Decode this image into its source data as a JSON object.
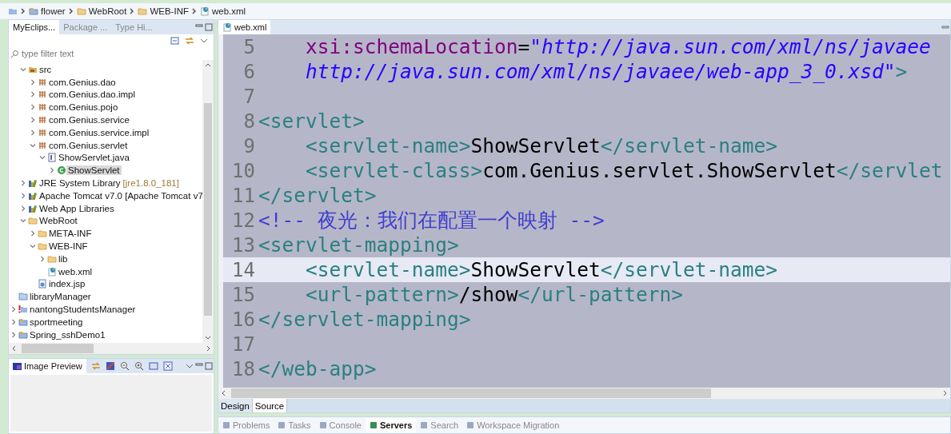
{
  "breadcrumb": [
    {
      "label": "flower",
      "kind": "project"
    },
    {
      "label": "WebRoot",
      "kind": "folder"
    },
    {
      "label": "WEB-INF",
      "kind": "folder"
    },
    {
      "label": "web.xml",
      "kind": "xml-file"
    }
  ],
  "explorer": {
    "tabs": [
      {
        "label": "MyEclips...",
        "selected": true
      },
      {
        "label": "Package ...",
        "selected": false
      },
      {
        "label": "Type Hi...",
        "selected": false
      }
    ],
    "filter": {
      "placeholder": "type filter text"
    },
    "tree": [
      {
        "children": [
          {
            "label": "src",
            "kind": "package-root",
            "expanded": true,
            "children": [
              {
                "label": "com.Genius.dao",
                "kind": "package",
                "expanded": false
              },
              {
                "label": "com.Genius.dao.impl",
                "kind": "package",
                "expanded": false
              },
              {
                "label": "com.Genius.pojo",
                "kind": "package",
                "expanded": false
              },
              {
                "label": "com.Genius.service",
                "kind": "package",
                "expanded": false
              },
              {
                "label": "com.Genius.service.impl",
                "kind": "package",
                "expanded": false
              },
              {
                "label": "com.Genius.servlet",
                "kind": "package",
                "expanded": true,
                "children": [
                  {
                    "label": "ShowServlet.java",
                    "kind": "java-file",
                    "expanded": true,
                    "children": [
                      {
                        "label": "ShowServlet",
                        "kind": "class",
                        "expanded": false,
                        "selected": true
                      }
                    ]
                  }
                ]
              }
            ]
          },
          {
            "label": "JRE System Library",
            "decoration": "[jre1.8.0_181]",
            "kind": "library",
            "expanded": false
          },
          {
            "label": "Apache Tomcat v7.0 [Apache Tomcat v7",
            "kind": "library",
            "expanded": false
          },
          {
            "label": "Web App Libraries",
            "kind": "library",
            "expanded": false
          },
          {
            "label": "WebRoot",
            "kind": "folder",
            "expanded": true,
            "children": [
              {
                "label": "META-INF",
                "kind": "folder",
                "expanded": false
              },
              {
                "label": "WEB-INF",
                "kind": "folder",
                "expanded": true,
                "children": [
                  {
                    "label": "lib",
                    "kind": "folder",
                    "expanded": false
                  },
                  {
                    "label": "web.xml",
                    "kind": "xml-file"
                  }
                ]
              },
              {
                "label": "index.jsp",
                "kind": "jsp-file"
              }
            ]
          }
        ]
      },
      {
        "label": "libraryManager",
        "kind": "closed-project"
      },
      {
        "label": "nantongStudentsManager",
        "kind": "project-error",
        "expanded": false
      },
      {
        "label": "sportmeeting",
        "kind": "project",
        "expanded": false
      },
      {
        "label": "Spring_sshDemo1",
        "kind": "project",
        "expanded": false
      }
    ]
  },
  "preview": {
    "tab": "Image Preview"
  },
  "editor": {
    "tab": "web.xml",
    "lines": [
      {
        "number": "5",
        "current": false,
        "tokens": [
          {
            "kind": "attr",
            "text": "    xsi:schemaLocation"
          },
          {
            "kind": "text",
            "text": "="
          },
          {
            "kind": "value",
            "text": "\"http://java.sun.com/xml/ns/javaee"
          }
        ]
      },
      {
        "number": "6",
        "current": false,
        "tokens": [
          {
            "kind": "value",
            "text": "    http://java.sun.com/xml/ns/javaee/web-app_3_0.xsd\""
          },
          {
            "kind": "tag",
            "text": ">"
          }
        ]
      },
      {
        "number": "7",
        "current": false
      },
      {
        "number": "8",
        "current": false,
        "tokens": [
          {
            "kind": "tag",
            "text": "<servlet>"
          }
        ]
      },
      {
        "number": "9",
        "current": false,
        "tokens": [
          {
            "kind": "tag",
            "text": "    <servlet-name>"
          },
          {
            "kind": "text",
            "text": "ShowServlet"
          },
          {
            "kind": "tag",
            "text": "</servlet-name>"
          }
        ]
      },
      {
        "number": "10",
        "current": false,
        "tokens": [
          {
            "kind": "tag",
            "text": "    <servlet-class>"
          },
          {
            "kind": "text",
            "text": "com.Genius.servlet.ShowServlet"
          },
          {
            "kind": "tag",
            "text": "</servlet"
          }
        ]
      },
      {
        "number": "11",
        "current": false,
        "tokens": [
          {
            "kind": "tag",
            "text": "</servlet>"
          }
        ]
      },
      {
        "number": "12",
        "current": false,
        "tokens": [
          {
            "kind": "comment",
            "text": "<!-- 夜光：我们在配置一个映射 -->"
          }
        ]
      },
      {
        "number": "13",
        "current": false,
        "tokens": [
          {
            "kind": "tag",
            "text": "<servlet-mapping>"
          }
        ]
      },
      {
        "number": "14",
        "current": true,
        "tokens": [
          {
            "kind": "tag",
            "text": "    <servlet-name>"
          },
          {
            "kind": "text",
            "text": "ShowServlet"
          },
          {
            "kind": "tag",
            "text": "</servlet-name>"
          }
        ]
      },
      {
        "number": "15",
        "current": false,
        "tokens": [
          {
            "kind": "tag",
            "text": "    <url-pattern>"
          },
          {
            "kind": "text",
            "text": "/show"
          },
          {
            "kind": "tag",
            "text": "</url-pattern>"
          }
        ]
      },
      {
        "number": "16",
        "current": false,
        "tokens": [
          {
            "kind": "tag",
            "text": "</servlet-mapping>"
          }
        ]
      },
      {
        "number": "17",
        "current": false
      },
      {
        "number": "18",
        "current": false,
        "tokens": [
          {
            "kind": "tag",
            "text": "</web-app>"
          }
        ]
      }
    ],
    "modes": [
      {
        "label": "Design",
        "selected": false
      },
      {
        "label": "Source",
        "selected": true
      }
    ]
  },
  "bottom_tabs": [
    {
      "label": "Problems",
      "selected": false
    },
    {
      "label": "Tasks",
      "selected": false
    },
    {
      "label": "Console",
      "selected": false
    },
    {
      "label": "Servers",
      "selected": true
    },
    {
      "label": "Search",
      "selected": false
    },
    {
      "label": "Workspace Migration",
      "selected": false
    }
  ]
}
